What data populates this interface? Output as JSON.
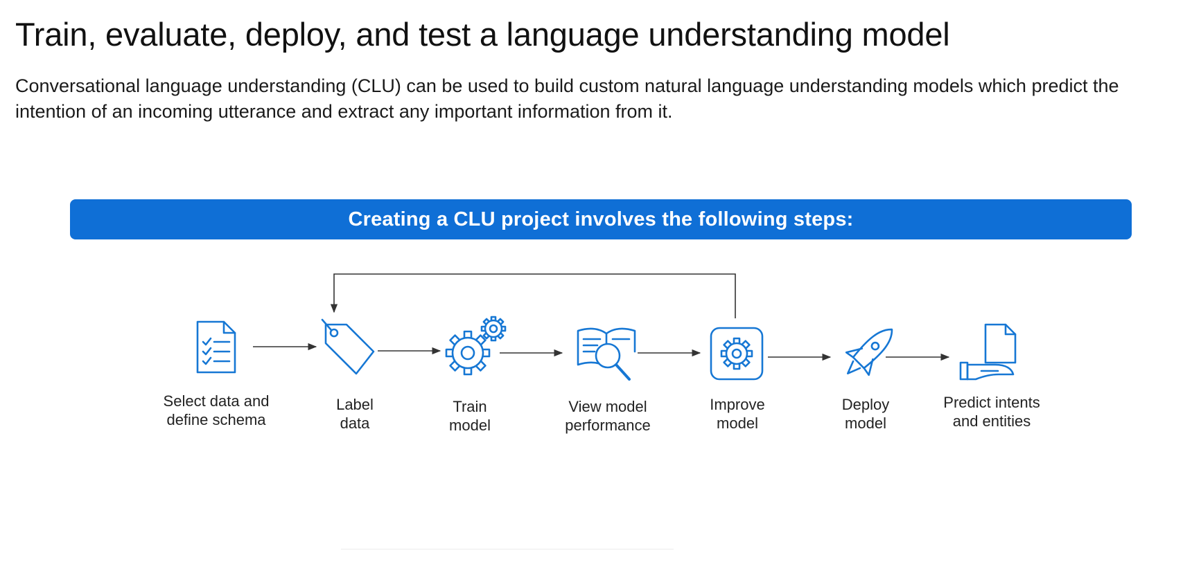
{
  "page": {
    "title": "Train, evaluate, deploy, and test a language understanding model",
    "intro": "Conversational language understanding (CLU) can be used to build custom natural language understanding models which predict the intention of an incoming utterance and extract any important information from it."
  },
  "banner": {
    "text": "Creating a CLU project involves the following steps:"
  },
  "colors": {
    "accent": "#0f6fd6",
    "icon": "#1677d4",
    "arrow": "#333333"
  },
  "steps": [
    {
      "icon": "checklist-document-icon",
      "line1": "Select data and",
      "line2": "define schema"
    },
    {
      "icon": "tag-icon",
      "line1": "Label",
      "line2": "data"
    },
    {
      "icon": "gears-icon",
      "line1": "Train",
      "line2": "model"
    },
    {
      "icon": "book-magnifier-icon",
      "line1": "View model",
      "line2": "performance"
    },
    {
      "icon": "gear-box-icon",
      "line1": "Improve",
      "line2": "model"
    },
    {
      "icon": "rocket-icon",
      "line1": "Deploy",
      "line2": "model"
    },
    {
      "icon": "hand-document-icon",
      "line1": "Predict intents",
      "line2": "and entities"
    }
  ],
  "feedback_loop": {
    "from_step": 5,
    "to_step": 2
  }
}
